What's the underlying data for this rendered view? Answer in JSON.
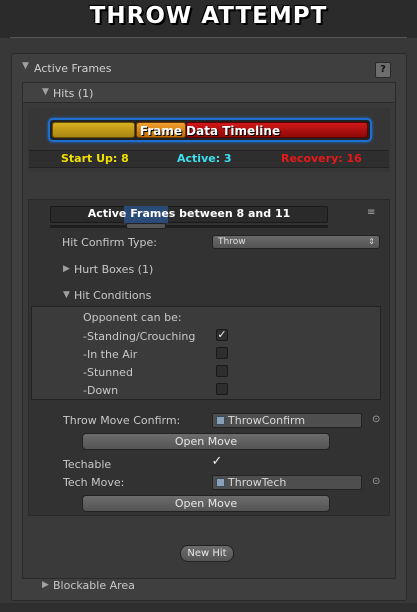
{
  "header": {
    "title": "THROW ATTEMPT"
  },
  "active_frames": {
    "label": "Active Frames",
    "help_label": "?",
    "hits": {
      "label": "Hits (1)",
      "timeline": {
        "title": "Frame Data Timeline",
        "startup": "Start Up: 8",
        "active": "Active: 3",
        "recovery": "Recovery: 16",
        "colors": {
          "startup": "#d8b020",
          "active": "#f0a030",
          "recovery": "#d01818",
          "frame": "#1e6fcf"
        }
      },
      "hit": {
        "active_frames_label": "Active Frames between 8 and 11",
        "menu_icon": "≡",
        "hit_confirm_type_label": "Hit Confirm Type:",
        "hit_confirm_type_value": "Throw",
        "hurt_boxes_label": "Hurt Boxes (1)",
        "hit_conditions_label": "Hit Conditions",
        "opponent_label": "Opponent can be:",
        "conditions": [
          {
            "label": "-Standing/Crouching",
            "checked": "✓"
          },
          {
            "label": "-In the Air",
            "checked": ""
          },
          {
            "label": "-Stunned",
            "checked": ""
          },
          {
            "label": "-Down",
            "checked": ""
          }
        ],
        "throw_move_confirm_label": "Throw Move Confirm:",
        "throw_move_confirm_value": "ThrowConfirm",
        "open_move_label": "Open Move",
        "techable_label": "Techable",
        "techable_check": "✓",
        "tech_move_label": "Tech Move:",
        "tech_move_value": "ThrowTech",
        "open_move_label_2": "Open Move",
        "pick_icon": "⊙"
      },
      "new_hit_label": "New Hit"
    },
    "blockable_area_label": "Blockable Area"
  }
}
